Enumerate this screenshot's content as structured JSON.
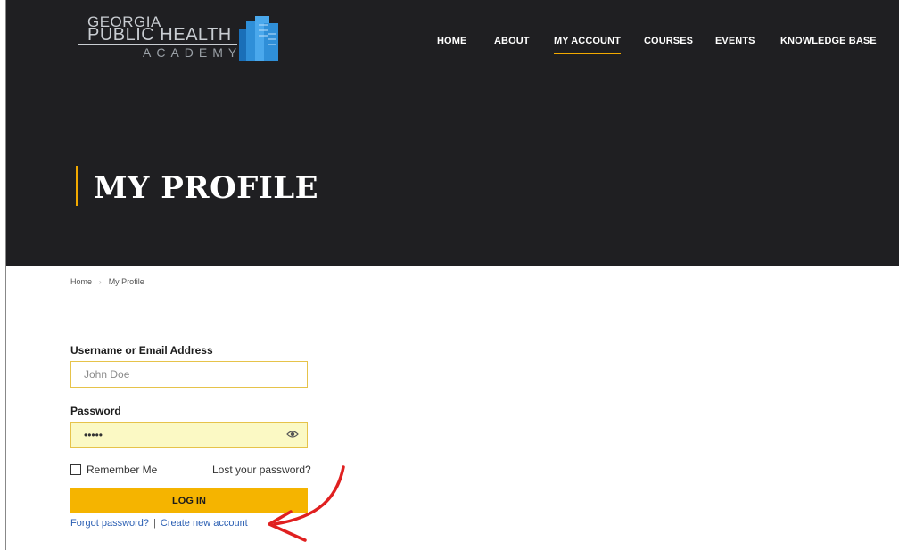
{
  "logo": {
    "line1": "GEORGIA",
    "line2": "PUBLIC HEALTH",
    "line3": "ACADEMY",
    "icon": "books-icon",
    "brand_blue": "#2f8fd8"
  },
  "nav": {
    "items": [
      {
        "label": "HOME",
        "active": false
      },
      {
        "label": "ABOUT",
        "active": false
      },
      {
        "label": "MY ACCOUNT",
        "active": true
      },
      {
        "label": "COURSES",
        "active": false
      },
      {
        "label": "EVENTS",
        "active": false
      },
      {
        "label": "KNOWLEDGE BASE",
        "active": false
      }
    ]
  },
  "hero": {
    "title": "MY PROFILE"
  },
  "breadcrumb": {
    "home": "Home",
    "separator": "›",
    "current": "My Profile"
  },
  "login_form": {
    "username_label": "Username or Email Address",
    "username_placeholder": "John Doe",
    "username_value": "",
    "password_label": "Password",
    "password_value": "•••••",
    "password_toggle_icon": "eye-icon",
    "remember_label": "Remember Me",
    "remember_checked": false,
    "lost_password_link": "Lost your password?",
    "login_button": "LOG IN",
    "forgot_password_link": "Forgot password?",
    "links_separator": "|",
    "create_account_link": "Create new account"
  },
  "annotation": {
    "icon": "red-arrow-icon",
    "color": "#e02020"
  },
  "colors": {
    "hero_bg": "#1f1f22",
    "accent": "#f2a900",
    "button": "#f5b400",
    "link": "#2b5fb3"
  }
}
